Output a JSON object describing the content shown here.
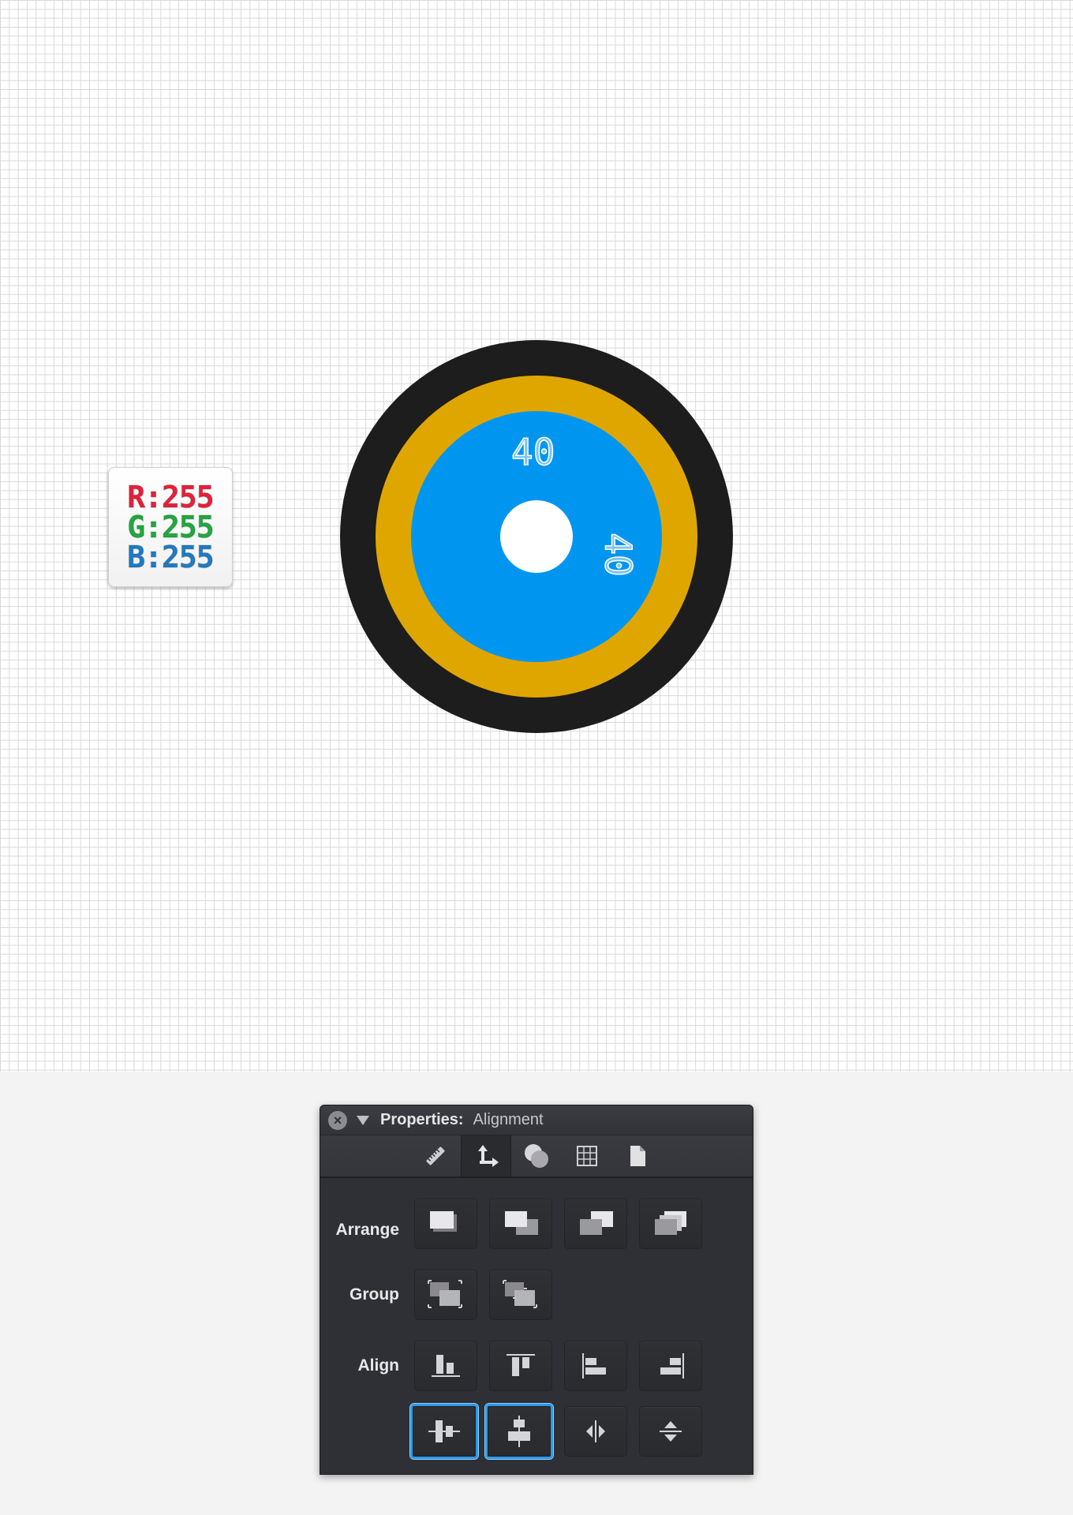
{
  "swatch": {
    "r_label": "R:255",
    "g_label": "G:255",
    "b_label": "B:255",
    "colors": {
      "r": "#e8203a",
      "g": "#1faa3e",
      "b": "#1f7cc4"
    }
  },
  "target": {
    "dim_top": "40",
    "dim_side": "40",
    "colors": {
      "outer": "#1d1d1d",
      "middle": "#e0a600",
      "inner": "#0096f0",
      "center": "#ffffff"
    }
  },
  "panel": {
    "title": "Properties:",
    "subtitle": "Alignment",
    "tabs": [
      "ruler-icon",
      "move-icon",
      "appearance-icon",
      "grid-icon",
      "document-icon"
    ],
    "active_tab": "move-icon",
    "arrange_label": "Arrange",
    "group_label": "Group",
    "align_label": "Align",
    "accent_color": "#2e9bea"
  }
}
